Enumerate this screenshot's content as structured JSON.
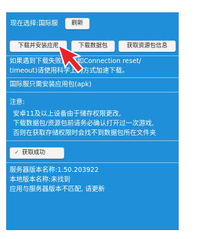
{
  "header": {
    "current_selection": "现在选择:国际服",
    "refresh_label": "刷新"
  },
  "toolbar": {
    "download_install_label": "下载并安装应用",
    "download_data_label": "下载数据包",
    "get_resource_info_label": "获取资源包信息"
  },
  "notice": {
    "line1": "如果遇到下载失败问题(如Connection reset/",
    "line2": "timeout)请使用科学上网方式加速下载。",
    "intl_note": "国际服只需安装应用包(apk)"
  },
  "warning": {
    "title": "注意:",
    "lines": [
      "安卓11及以上设备由于储存权限更改,",
      "下载数据包/资源包前请务必确认打开过一次游戏,",
      "否则在获取存储权限时会找不到数据包所在文件夹"
    ]
  },
  "status": {
    "success_label": "获取成功"
  },
  "version": {
    "server_version": "服务器版本名称:1.50.203922",
    "local_version": "本地版本名称:未找到",
    "mismatch": "应用与服务器版本不匹配, 请更新"
  },
  "colors": {
    "panel_bg": "#1f8fd9",
    "button_bg": "#f4f4f4",
    "arrow": "#e8232a",
    "check": "#1a6fc2"
  }
}
